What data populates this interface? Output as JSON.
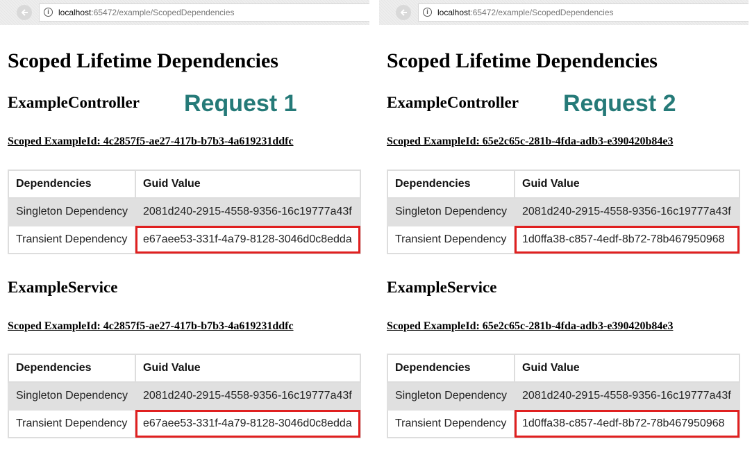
{
  "panels": [
    {
      "url_host": "localhost",
      "url_rest": ":65472/example/ScopedDependencies",
      "page_title": "Scoped Lifetime Dependencies",
      "request_label": "Request 1",
      "controller": {
        "heading": "ExampleController",
        "scoped_text": "Scoped ExampleId: 4c2857f5-ae27-417b-b7b3-4a619231ddfc",
        "table": {
          "headers": [
            "Dependencies",
            "Guid Value"
          ],
          "rows": [
            [
              "Singleton Dependency",
              "2081d240-2915-4558-9356-16c19777a43f"
            ],
            [
              "Transient Dependency",
              "e67aee53-331f-4a79-8128-3046d0c8edda"
            ]
          ]
        }
      },
      "service": {
        "heading": "ExampleService",
        "scoped_text": "Scoped ExampleId: 4c2857f5-ae27-417b-b7b3-4a619231ddfc",
        "table": {
          "headers": [
            "Dependencies",
            "Guid Value"
          ],
          "rows": [
            [
              "Singleton Dependency",
              "2081d240-2915-4558-9356-16c19777a43f"
            ],
            [
              "Transient Dependency",
              "e67aee53-331f-4a79-8128-3046d0c8edda"
            ]
          ]
        }
      }
    },
    {
      "url_host": "localhost",
      "url_rest": ":65472/example/ScopedDependencies",
      "page_title": "Scoped Lifetime Dependencies",
      "request_label": "Request 2",
      "controller": {
        "heading": "ExampleController",
        "scoped_text": "Scoped ExampleId: 65e2c65c-281b-4fda-adb3-e390420b84e3",
        "table": {
          "headers": [
            "Dependencies",
            "Guid Value"
          ],
          "rows": [
            [
              "Singleton Dependency",
              "2081d240-2915-4558-9356-16c19777a43f"
            ],
            [
              "Transient Dependency",
              "1d0ffa38-c857-4edf-8b72-78b467950968"
            ]
          ]
        }
      },
      "service": {
        "heading": "ExampleService",
        "scoped_text": "Scoped ExampleId: 65e2c65c-281b-4fda-adb3-e390420b84e3",
        "table": {
          "headers": [
            "Dependencies",
            "Guid Value"
          ],
          "rows": [
            [
              "Singleton Dependency",
              "2081d240-2915-4558-9356-16c19777a43f"
            ],
            [
              "Transient Dependency",
              "1d0ffa38-c857-4edf-8b72-78b467950968"
            ]
          ]
        }
      }
    }
  ],
  "icons": {
    "back": "back-arrow-icon",
    "info": "info-icon"
  },
  "colors": {
    "request_label": "#257a78",
    "highlight": "#e02020",
    "alt_row": "#e0e0e0"
  }
}
